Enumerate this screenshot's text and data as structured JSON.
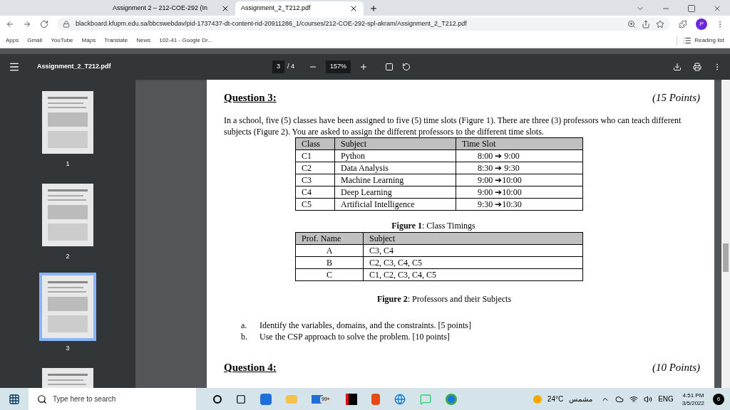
{
  "browser": {
    "tabs": [
      {
        "title": "Assignment 2 – 212-COE-292 (In",
        "selected": false
      },
      {
        "title": "Assignment_2_T212.pdf",
        "selected": true
      }
    ],
    "url": "blackboard.kfupm.edu.sa/bbcswebdav/pid-1737437-dt-content-rid-20911286_1/courses/212-COE-292-spl-akram/Assignment_2_T212.pdf",
    "profile": "P",
    "bookmarks": [
      "Apps",
      "Gmail",
      "YouTube",
      "Maps",
      "Translate",
      "News",
      "102-41 - Google Dr..."
    ],
    "reading_list": "Reading list"
  },
  "viewer": {
    "file": "Assignment_2_T212.pdf",
    "page": "3",
    "pages": "/ 4",
    "zoom": "157%",
    "thumbnails": [
      {
        "number": "1",
        "selected": false
      },
      {
        "number": "2",
        "selected": false
      },
      {
        "number": "3",
        "selected": true
      },
      {
        "selected": false
      }
    ]
  },
  "document": {
    "question": {
      "title": "Question 3:",
      "points": "(15 Points)"
    },
    "intro": "In a school, five (5) classes have been assigned to five (5) time slots (Figure 1). There are three (3) professors who can teach different subjects (Figure 2).  You are asked to assign the different professors to the different time slots.",
    "table1": {
      "columns": [
        "Class",
        "Subject",
        "Time Slot"
      ],
      "rows": [
        [
          "C1",
          "Python",
          "8:00 ➔ 9:00"
        ],
        [
          "C2",
          "Data Analysis",
          "8:30 ➔ 9:30"
        ],
        [
          "C3",
          "Machine Learning",
          "9:00 ➔10:00"
        ],
        [
          "C4",
          "Deep Learning",
          "9:00 ➔10:00"
        ],
        [
          "C5",
          "Artificial Intelligence",
          "9:30 ➔10:30"
        ]
      ],
      "caption": "**Figure 1**: Class Timings"
    },
    "table2": {
      "columns": [
        "Prof. Name",
        "Subject"
      ],
      "rows": [
        [
          "A",
          "C3, C4"
        ],
        [
          "B",
          "C2, C3, C4, C5"
        ],
        [
          "C",
          "C1, C2, C3, C4, C5"
        ]
      ],
      "caption": "**Figure 2**: Professors and their Subjects"
    },
    "tasks": [
      {
        "marker": "a.",
        "text": "Identify the variables, domains, and the constraints. [5 points]"
      },
      {
        "marker": "b.",
        "text": "Use the CSP approach to solve the problem. [10 points]"
      }
    ],
    "next_question": {
      "title": "Question 4:",
      "points": "(10 Points)"
    }
  },
  "taskbar": {
    "search_placeholder": "Type here to search",
    "badge": "99+",
    "weather": "24°C",
    "weather_text": "مشمس",
    "language": "ENG",
    "time": "4:51 PM",
    "date": "3/5/2022",
    "notifications": "6"
  }
}
